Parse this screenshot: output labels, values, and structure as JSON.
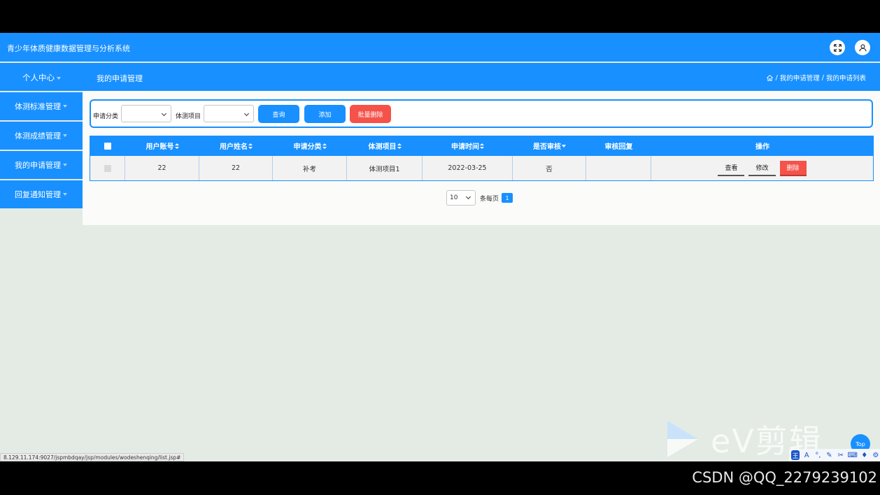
{
  "header": {
    "app_title": "青少年体质健康数据管理与分析系统",
    "icons": [
      "fullscreen-icon",
      "user-icon"
    ]
  },
  "navbar": {
    "personal_center": "个人中心",
    "current_page": "我的申请管理",
    "breadcrumb": {
      "item1": "我的申请管理",
      "sep": "/",
      "item2": "我的申请列表"
    }
  },
  "sidebar": {
    "items": [
      {
        "label": "体测标准管理"
      },
      {
        "label": "体测成绩管理"
      },
      {
        "label": "我的申请管理"
      },
      {
        "label": "回复通知管理"
      }
    ]
  },
  "search": {
    "category_label": "申请分类",
    "category_value": "",
    "project_label": "体测项目",
    "project_value": "",
    "query_button": "查询",
    "add_button": "添加",
    "batch_delete_button": "批量删除"
  },
  "table": {
    "columns": [
      "用户账号",
      "用户姓名",
      "申请分类",
      "体测项目",
      "申请时间",
      "是否审核",
      "审核回复",
      "操作"
    ],
    "rows": [
      {
        "account": "22",
        "name": "22",
        "category": "补考",
        "project": "体测项目1",
        "time": "2022-03-25",
        "reviewed": "否",
        "reply": "",
        "actions": {
          "view": "查看",
          "edit": "修改",
          "delete": "删除"
        }
      }
    ]
  },
  "pagination": {
    "page_size": "10",
    "per_page_label": "条每页",
    "current_page": "1"
  },
  "colors": {
    "primary": "#1890ff",
    "danger": "#f5524a",
    "background": "#e3ebe4"
  },
  "status_url": "8.129.11.174:9027/jspmbdqay/jsp/modules/wodeshenqing/list.jsp#",
  "top_button": "Top",
  "watermark": {
    "brand": "eV剪辑"
  },
  "csdn_watermark": "CSDN @QQ_2279239102",
  "ime_toolbar": {
    "mode": "王",
    "letter": "A"
  }
}
